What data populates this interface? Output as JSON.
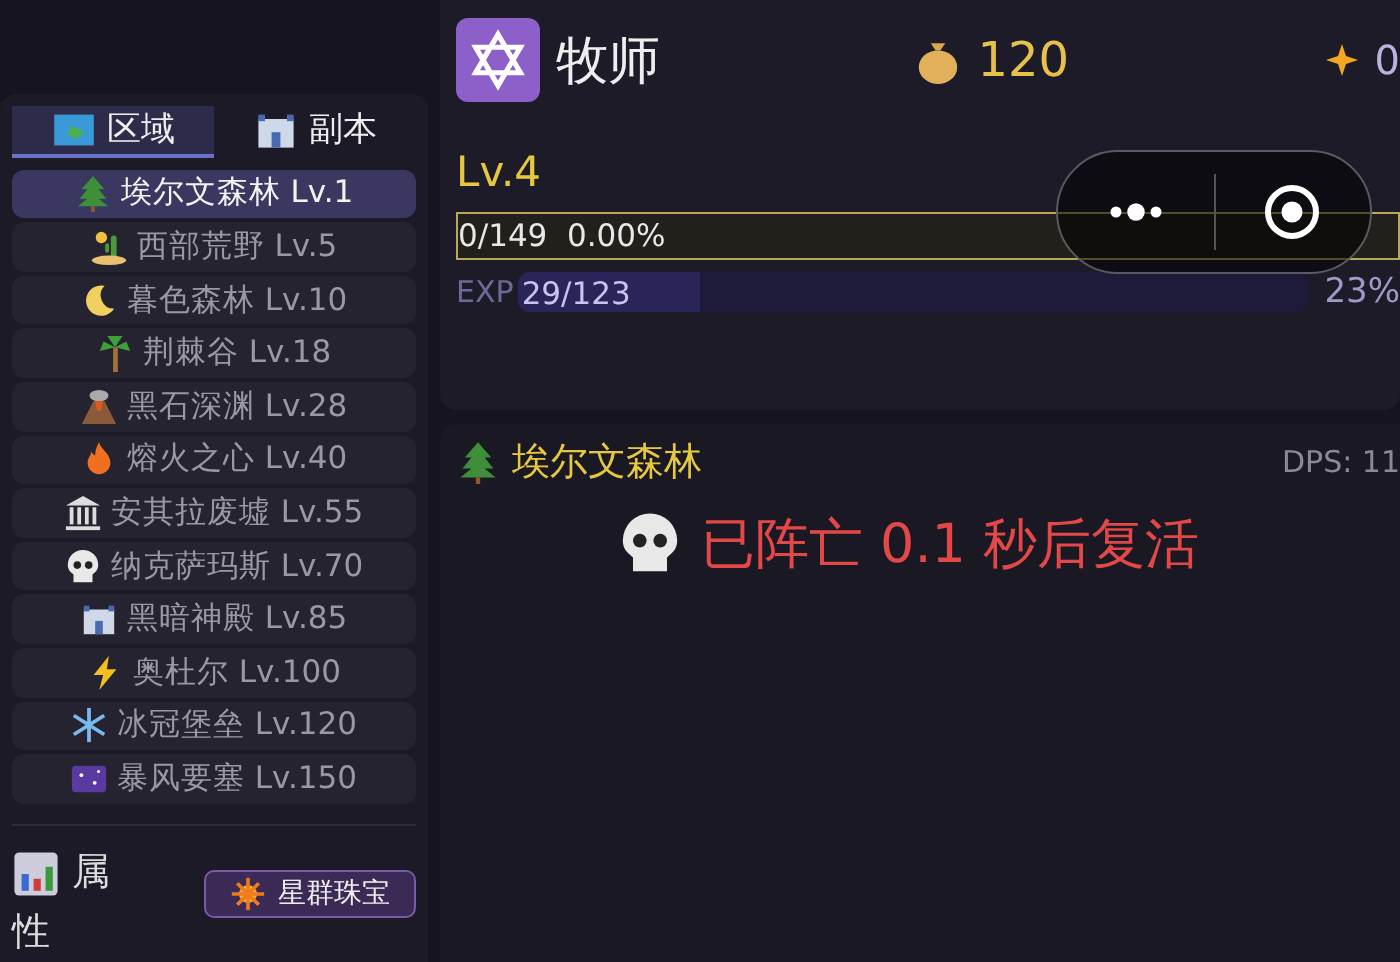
{
  "sidebar": {
    "tabs": [
      {
        "label": "区域",
        "selected": true
      },
      {
        "label": "副本",
        "selected": false
      }
    ],
    "zones": [
      {
        "label": "埃尔文森林 Lv.1",
        "selected": true
      },
      {
        "label": "西部荒野 Lv.5",
        "selected": false
      },
      {
        "label": "暮色森林 Lv.10",
        "selected": false
      },
      {
        "label": "荆棘谷 Lv.18",
        "selected": false
      },
      {
        "label": "黑石深渊 Lv.28",
        "selected": false
      },
      {
        "label": "熔火之心 Lv.40",
        "selected": false
      },
      {
        "label": "安其拉废墟 Lv.55",
        "selected": false
      },
      {
        "label": "纳克萨玛斯 Lv.70",
        "selected": false
      },
      {
        "label": "黑暗神殿 Lv.85",
        "selected": false
      },
      {
        "label": "奥杜尔 Lv.100",
        "selected": false
      },
      {
        "label": "冰冠堡垒 Lv.120",
        "selected": false
      },
      {
        "label": "暴风要塞 Lv.150",
        "selected": false
      }
    ],
    "stats_label": "属性",
    "jewel_button": "星群珠宝"
  },
  "header": {
    "class_name": "牧师",
    "gold": "120",
    "stars": "0",
    "level": "Lv.4",
    "level_bar": {
      "text": "0/149  0.00%",
      "level": 0
    },
    "exp_bar": {
      "label": "EXP",
      "text": "29/123",
      "level": 0.23,
      "percent": "23%"
    }
  },
  "battle": {
    "zone": "埃尔文森林",
    "dps": "DPS: 11",
    "status": "已阵亡 0.1 秒后复活"
  }
}
